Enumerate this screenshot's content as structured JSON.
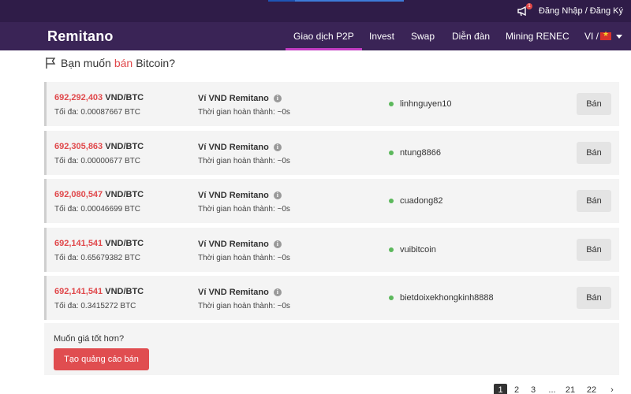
{
  "topbar": {
    "notification_count": "1",
    "auth_label": "Đăng Nhập / Đăng Ký"
  },
  "navbar": {
    "brand": "Remitano",
    "items": [
      {
        "label": "Giao dịch P2P",
        "active": true
      },
      {
        "label": "Invest"
      },
      {
        "label": "Swap"
      },
      {
        "label": "Diễn đàn"
      },
      {
        "label": "Mining RENEC"
      }
    ],
    "language": "VI /"
  },
  "page": {
    "heading_prefix": "Bạn muốn",
    "heading_action": "bán",
    "heading_suffix": "Bitcoin?"
  },
  "offers": [
    {
      "price": "692,292,403",
      "unit": "VND/BTC",
      "max": "Tối đa: 0.00087667 BTC",
      "wallet": "Ví VND Remitano",
      "time": "Thời gian hoàn thành: ~0s",
      "user": "linhnguyen10",
      "button": "Bán"
    },
    {
      "price": "692,305,863",
      "unit": "VND/BTC",
      "max": "Tối đa: 0.00000677 BTC",
      "wallet": "Ví VND Remitano",
      "time": "Thời gian hoàn thành: ~0s",
      "user": "ntung8866",
      "button": "Bán"
    },
    {
      "price": "692,080,547",
      "unit": "VND/BTC",
      "max": "Tối đa: 0.00046699 BTC",
      "wallet": "Ví VND Remitano",
      "time": "Thời gian hoàn thành: ~0s",
      "user": "cuadong82",
      "button": "Bán"
    },
    {
      "price": "692,141,541",
      "unit": "VND/BTC",
      "max": "Tối đa: 0.65679382 BTC",
      "wallet": "Ví VND Remitano",
      "time": "Thời gian hoàn thành: ~0s",
      "user": "vuibitcoin",
      "button": "Bán"
    },
    {
      "price": "692,141,541",
      "unit": "VND/BTC",
      "max": "Tối đa: 0.3415272 BTC",
      "wallet": "Ví VND Remitano",
      "time": "Thời gian hoàn thành: ~0s",
      "user": "bietdoixekhongkinh8888",
      "button": "Bán"
    }
  ],
  "better_price": {
    "question": "Muốn giá tốt hơn?",
    "button": "Tạo quảng cáo bán"
  },
  "pagination": {
    "pages": [
      "1",
      "2",
      "3",
      "...",
      "21",
      "22",
      "›"
    ],
    "current": "1"
  },
  "colors": {
    "topbar_bg": "#2f1c48",
    "navbar_bg": "#3a2456",
    "accent_red": "#e0484b",
    "online_green": "#5cb85c"
  }
}
